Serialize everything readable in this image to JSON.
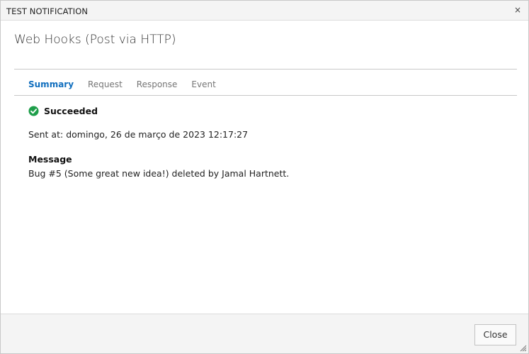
{
  "dialog": {
    "title": "TEST NOTIFICATION",
    "close_glyph": "×"
  },
  "header": {
    "title": "Web Hooks (Post via HTTP)"
  },
  "tabs": [
    {
      "label": "Summary",
      "active": true
    },
    {
      "label": "Request",
      "active": false
    },
    {
      "label": "Response",
      "active": false
    },
    {
      "label": "Event",
      "active": false
    }
  ],
  "summary": {
    "status_icon": "check-circle-icon",
    "status_color": "#1e9e4a",
    "status_text": "Succeeded",
    "sent_at_label": "Sent at:",
    "sent_at_value": "domingo, 26 de março de 2023 12:17:27",
    "message_heading": "Message",
    "message_text": "Bug #5 (Some great new idea!) deleted by Jamal Hartnett."
  },
  "footer": {
    "close_label": "Close"
  },
  "colors": {
    "accent": "#106ebe",
    "success": "#1e9e4a"
  }
}
